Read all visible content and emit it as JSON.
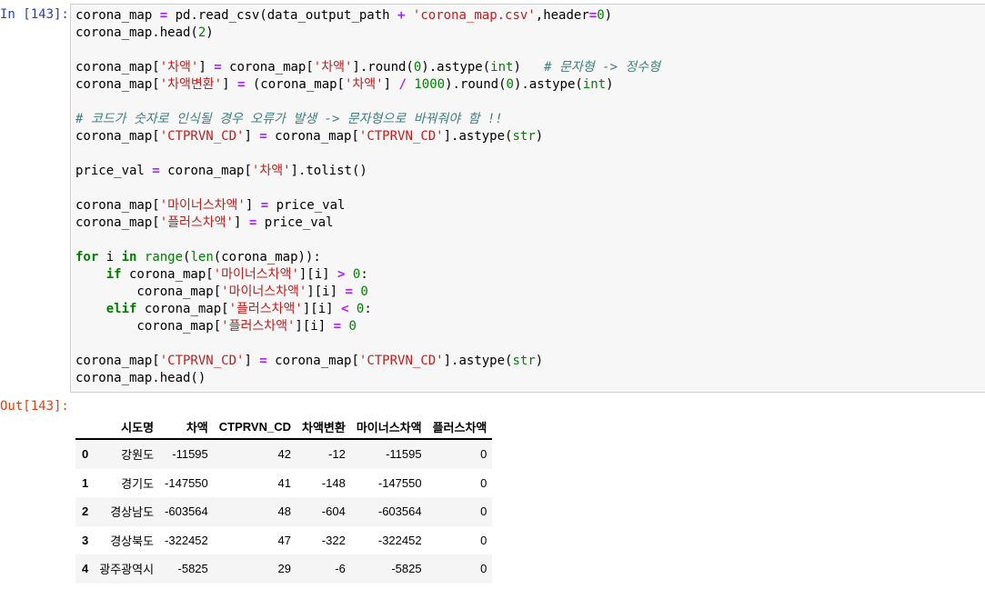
{
  "cell": {
    "in_prompt": "In [143]:",
    "out_prompt": "Out[143]:"
  },
  "code_lines": [
    [
      [
        "t",
        "corona_map "
      ],
      [
        "o",
        "="
      ],
      [
        "t",
        " pd.read_csv(data_output_path "
      ],
      [
        "o",
        "+"
      ],
      [
        "t",
        " "
      ],
      [
        "s",
        "'corona_map.csv'"
      ],
      [
        "t",
        ",header"
      ],
      [
        "o",
        "="
      ],
      [
        "n",
        "0"
      ],
      [
        "t",
        ")"
      ]
    ],
    [
      [
        "t",
        "corona_map.head("
      ],
      [
        "n",
        "2"
      ],
      [
        "t",
        ")"
      ]
    ],
    [],
    [
      [
        "t",
        "corona_map["
      ],
      [
        "s",
        "'차액'"
      ],
      [
        "t",
        "] "
      ],
      [
        "o",
        "="
      ],
      [
        "t",
        " corona_map["
      ],
      [
        "s",
        "'차액'"
      ],
      [
        "t",
        "].round("
      ],
      [
        "n",
        "0"
      ],
      [
        "t",
        ").astype("
      ],
      [
        "b",
        "int"
      ],
      [
        "t",
        ")   "
      ],
      [
        "c",
        "# 문자형 -> 정수형"
      ]
    ],
    [
      [
        "t",
        "corona_map["
      ],
      [
        "s",
        "'차액변환'"
      ],
      [
        "t",
        "] "
      ],
      [
        "o",
        "="
      ],
      [
        "t",
        " (corona_map["
      ],
      [
        "s",
        "'차액'"
      ],
      [
        "t",
        "] "
      ],
      [
        "o",
        "/"
      ],
      [
        "t",
        " "
      ],
      [
        "n",
        "1000"
      ],
      [
        "t",
        ").round("
      ],
      [
        "n",
        "0"
      ],
      [
        "t",
        ").astype("
      ],
      [
        "b",
        "int"
      ],
      [
        "t",
        ")"
      ]
    ],
    [],
    [
      [
        "c",
        "# 코드가 숫자로 인식될 경우 오류가 발생 -> 문자형으로 바꿔줘야 함 !!"
      ]
    ],
    [
      [
        "t",
        "corona_map["
      ],
      [
        "s",
        "'CTPRVN_CD'"
      ],
      [
        "t",
        "] "
      ],
      [
        "o",
        "="
      ],
      [
        "t",
        " corona_map["
      ],
      [
        "s",
        "'CTPRVN_CD'"
      ],
      [
        "t",
        "].astype("
      ],
      [
        "b",
        "str"
      ],
      [
        "t",
        ")"
      ]
    ],
    [],
    [
      [
        "t",
        "price_val "
      ],
      [
        "o",
        "="
      ],
      [
        "t",
        " corona_map["
      ],
      [
        "s",
        "'차액'"
      ],
      [
        "t",
        "].tolist()"
      ]
    ],
    [],
    [
      [
        "t",
        "corona_map["
      ],
      [
        "s",
        "'마이너스차액'"
      ],
      [
        "t",
        "] "
      ],
      [
        "o",
        "="
      ],
      [
        "t",
        " price_val"
      ]
    ],
    [
      [
        "t",
        "corona_map["
      ],
      [
        "s",
        "'플러스차액'"
      ],
      [
        "t",
        "] "
      ],
      [
        "o",
        "="
      ],
      [
        "t",
        " price_val"
      ]
    ],
    [],
    [
      [
        "k",
        "for"
      ],
      [
        "t",
        " i "
      ],
      [
        "k",
        "in"
      ],
      [
        "t",
        " "
      ],
      [
        "b",
        "range"
      ],
      [
        "t",
        "("
      ],
      [
        "b",
        "len"
      ],
      [
        "t",
        "(corona_map)):"
      ]
    ],
    [
      [
        "t",
        "    "
      ],
      [
        "k",
        "if"
      ],
      [
        "t",
        " corona_map["
      ],
      [
        "s",
        "'마이너스차액'"
      ],
      [
        "t",
        "][i] "
      ],
      [
        "o",
        ">"
      ],
      [
        "t",
        " "
      ],
      [
        "n",
        "0"
      ],
      [
        "t",
        ":"
      ]
    ],
    [
      [
        "t",
        "        corona_map["
      ],
      [
        "s",
        "'마이너스차액'"
      ],
      [
        "t",
        "][i] "
      ],
      [
        "o",
        "="
      ],
      [
        "t",
        " "
      ],
      [
        "n",
        "0"
      ]
    ],
    [
      [
        "t",
        "    "
      ],
      [
        "k",
        "elif"
      ],
      [
        "t",
        " corona_map["
      ],
      [
        "s",
        "'플러스차액'"
      ],
      [
        "t",
        "][i] "
      ],
      [
        "o",
        "<"
      ],
      [
        "t",
        " "
      ],
      [
        "n",
        "0"
      ],
      [
        "t",
        ":"
      ]
    ],
    [
      [
        "t",
        "        corona_map["
      ],
      [
        "s",
        "'플러스차액'"
      ],
      [
        "t",
        "][i] "
      ],
      [
        "o",
        "="
      ],
      [
        "t",
        " "
      ],
      [
        "n",
        "0"
      ]
    ],
    [],
    [
      [
        "t",
        "corona_map["
      ],
      [
        "s",
        "'CTPRVN_CD'"
      ],
      [
        "t",
        "] "
      ],
      [
        "o",
        "="
      ],
      [
        "t",
        " corona_map["
      ],
      [
        "s",
        "'CTPRVN_CD'"
      ],
      [
        "t",
        "].astype("
      ],
      [
        "b",
        "str"
      ],
      [
        "t",
        ")"
      ]
    ],
    [
      [
        "t",
        "corona_map.head()"
      ]
    ]
  ],
  "table": {
    "columns": [
      "",
      "시도명",
      "차액",
      "CTPRVN_CD",
      "차액변환",
      "마이너스차액",
      "플러스차액"
    ],
    "rows": [
      [
        "0",
        "강원도",
        "-11595",
        "42",
        "-12",
        "-11595",
        "0"
      ],
      [
        "1",
        "경기도",
        "-147550",
        "41",
        "-148",
        "-147550",
        "0"
      ],
      [
        "2",
        "경상남도",
        "-603564",
        "48",
        "-604",
        "-603564",
        "0"
      ],
      [
        "3",
        "경상북도",
        "-322452",
        "47",
        "-322",
        "-322452",
        "0"
      ],
      [
        "4",
        "광주광역시",
        "-5825",
        "29",
        "-6",
        "-5825",
        "0"
      ]
    ]
  }
}
